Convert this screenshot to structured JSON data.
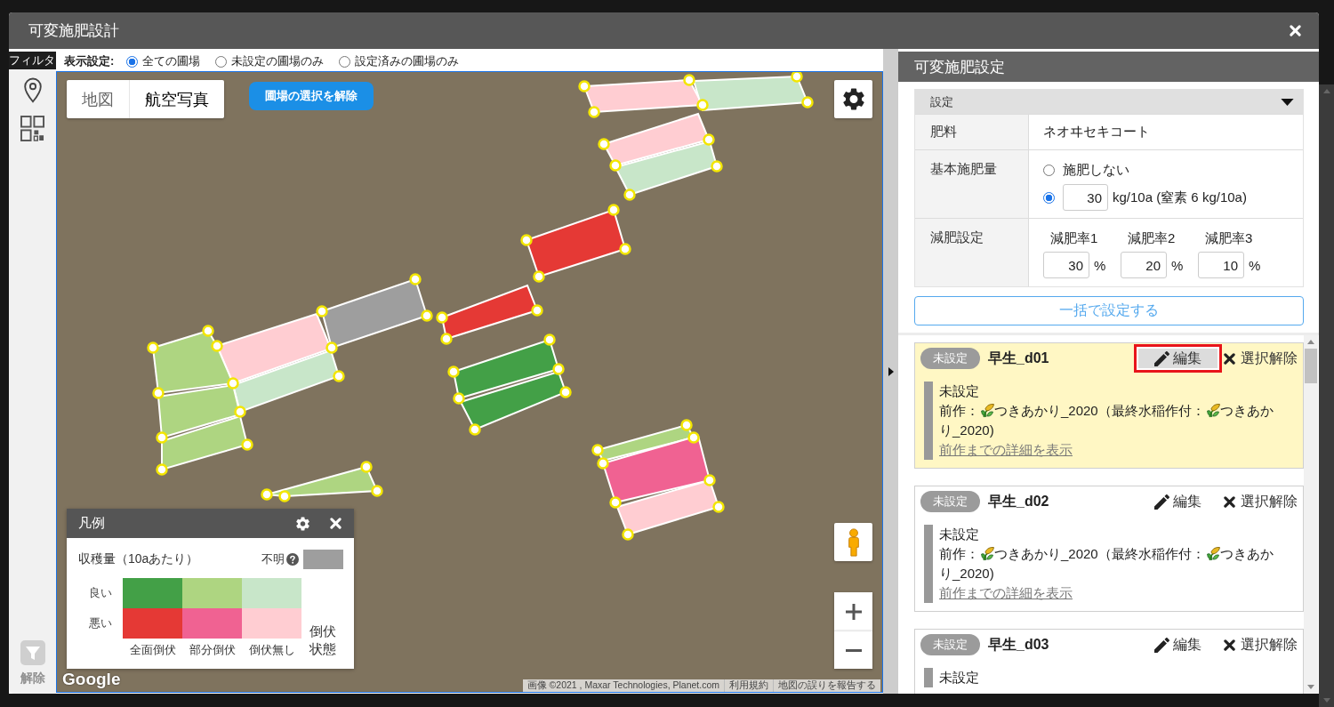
{
  "window": {
    "title": "可変施肥設計"
  },
  "sidebar": {
    "header": "フィルタ",
    "clear_filter": {
      "label": "解除",
      "disabled": true
    }
  },
  "display_settings": {
    "label": "表示設定:",
    "options": [
      {
        "label": "全ての圃場",
        "selected": true
      },
      {
        "label": "未設定の圃場のみ",
        "selected": false
      },
      {
        "label": "設定済みの圃場のみ",
        "selected": false
      }
    ]
  },
  "map": {
    "map_types": [
      {
        "label": "地図",
        "selected": false
      },
      {
        "label": "航空写真",
        "selected": true
      }
    ],
    "deselect_button": "圃場の選択を解除",
    "fields": [
      {
        "color": "#ffcdd2"
      },
      {
        "color": "#c8e6c9"
      },
      {
        "color": "#ffcdd2"
      },
      {
        "color": "#c8e6c9"
      },
      {
        "color": "#e53935"
      },
      {
        "color": "#9e9e9e"
      },
      {
        "color": "#e53935"
      },
      {
        "color": "#ffcdd2"
      },
      {
        "color": "#c8e6c9"
      },
      {
        "color": "#aed581"
      },
      {
        "color": "#aed581"
      },
      {
        "color": "#aed581"
      },
      {
        "color": "#43a047"
      },
      {
        "color": "#43a047"
      },
      {
        "color": "#aed581"
      },
      {
        "color": "#aed581"
      },
      {
        "color": "#f06292"
      },
      {
        "color": "#ffcdd2"
      }
    ],
    "logo": "Google",
    "attribution": [
      "画像 ©2021 , Maxar Technologies, Planet.com",
      "利用規約",
      "地図の誤りを報告する"
    ],
    "legend": {
      "title": "凡例",
      "metric": "収穫量（10aあたり）",
      "unknown": {
        "label": "不明",
        "color": "#9e9e9e"
      },
      "rows": [
        {
          "label": "良い",
          "cells": [
            {
              "color": "#43a047"
            },
            {
              "color": "#aed581"
            },
            {
              "color": "#c8e6c9"
            }
          ]
        },
        {
          "label": "悪い",
          "cells": [
            {
              "color": "#e53935"
            },
            {
              "color": "#f06292"
            },
            {
              "color": "#ffcdd2"
            }
          ]
        }
      ],
      "columns": [
        "全面倒伏",
        "部分倒伏",
        "倒伏無し"
      ],
      "axis_label": "倒伏状態"
    }
  },
  "panel": {
    "title": "可変施肥設定",
    "settings": {
      "header": "設定",
      "expanded": true,
      "rows": [
        {
          "kind": "text",
          "label": "肥料",
          "value": "ネオヰセキコート"
        },
        {
          "kind": "amount",
          "label": "基本施肥量",
          "options": [
            {
              "kind": "label",
              "label": "施肥しない",
              "selected": false
            },
            {
              "kind": "input",
              "value": "30",
              "unit": "kg/10a (窒素 6 kg/10a)",
              "selected": true
            }
          ]
        },
        {
          "kind": "rates",
          "label": "減肥設定",
          "rates": [
            {
              "label": "減肥率1",
              "value": "30",
              "unit": "%"
            },
            {
              "label": "減肥率2",
              "value": "20",
              "unit": "%"
            },
            {
              "label": "減肥率3",
              "value": "10",
              "unit": "%"
            }
          ]
        }
      ]
    },
    "apply_button": "一括で設定する",
    "fields": [
      {
        "status": "未設定",
        "name": "早生_d01",
        "selected": true,
        "edit": {
          "label": "編集",
          "highlighted": true
        },
        "deselect": "選択解除",
        "state": "未設定",
        "previous": {
          "label": "前作：",
          "crop": "つきあかり_2020",
          "last_label": "（最終水稲作付：",
          "last_crop": "つきあかり_2020)"
        },
        "details_link": "前作までの詳細を表示"
      },
      {
        "status": "未設定",
        "name": "早生_d02",
        "selected": false,
        "edit": {
          "label": "編集",
          "highlighted": false
        },
        "deselect": "選択解除",
        "state": "未設定",
        "previous": {
          "label": "前作：",
          "crop": "つきあかり_2020",
          "last_label": "（最終水稲作付：",
          "last_crop": "つきあかり_2020)"
        },
        "details_link": "前作までの詳細を表示"
      },
      {
        "status": "未設定",
        "name": "早生_d03",
        "selected": false,
        "edit": {
          "label": "編集",
          "highlighted": false
        },
        "deselect": "選択解除",
        "state": "未設定"
      }
    ]
  }
}
